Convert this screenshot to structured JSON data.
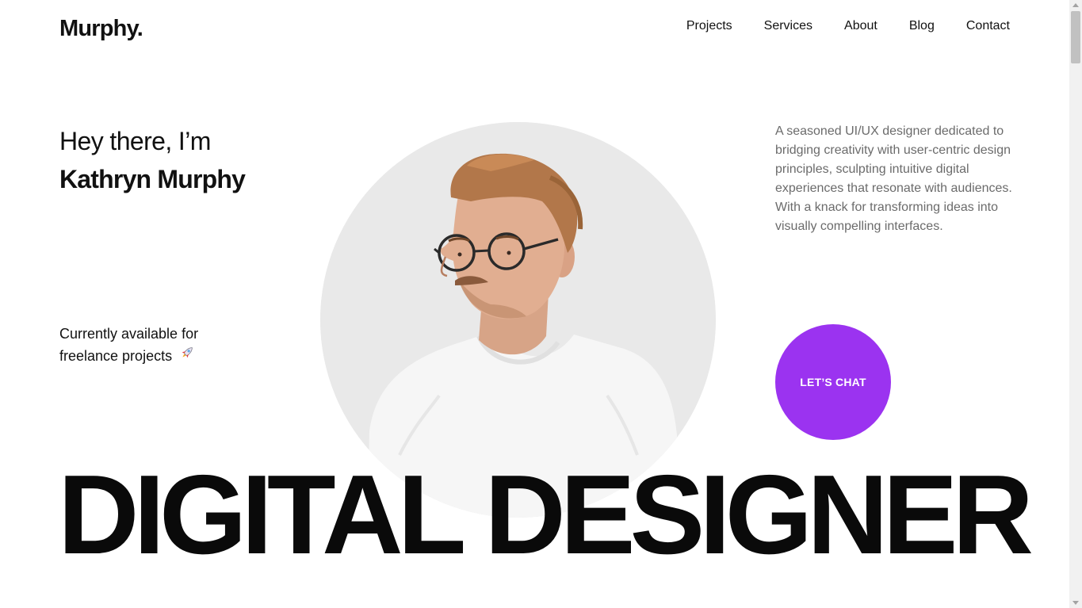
{
  "brand": {
    "logo": "Murphy."
  },
  "nav": {
    "items": [
      {
        "label": "Projects"
      },
      {
        "label": "Services"
      },
      {
        "label": "About"
      },
      {
        "label": "Blog"
      },
      {
        "label": "Contact"
      }
    ]
  },
  "hero": {
    "greeting": "Hey there, I’m",
    "name": "Kathryn Murphy",
    "availability": "Currently available for freelance projects",
    "availability_icon": "rocket-icon",
    "description": "A seasoned UI/UX designer dedicated to bridging creativity with user-centric design principles, sculpting intuitive digital experiences that resonate with audiences. With a knack for transforming ideas into visually compelling interfaces.",
    "cta_label": "LET’S CHAT",
    "headline": "DIGITAL DESIGNER"
  },
  "colors": {
    "accent": "#9b33f0",
    "portrait_bg": "#e9e9e9",
    "text": "#111111",
    "muted": "#6b6b6b"
  }
}
